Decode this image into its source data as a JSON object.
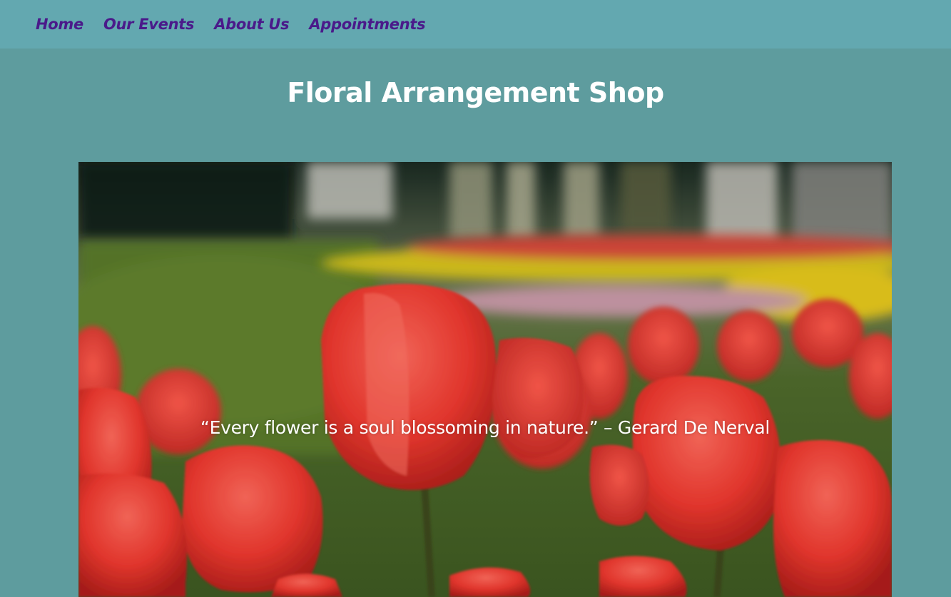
{
  "nav": {
    "items": [
      {
        "label": "Home"
      },
      {
        "label": "Our Events"
      },
      {
        "label": "About Us"
      },
      {
        "label": "Appointments"
      }
    ]
  },
  "header": {
    "title": "Floral Arrangement Shop"
  },
  "hero": {
    "quote": "“Every flower is a soul blossoming in nature.” – Gerard De Nerval"
  },
  "colors": {
    "page_background": "#5e9c9e",
    "navbar_background": "#63a8b0",
    "nav_link": "#4a1a8a",
    "title_text": "#ffffff"
  }
}
